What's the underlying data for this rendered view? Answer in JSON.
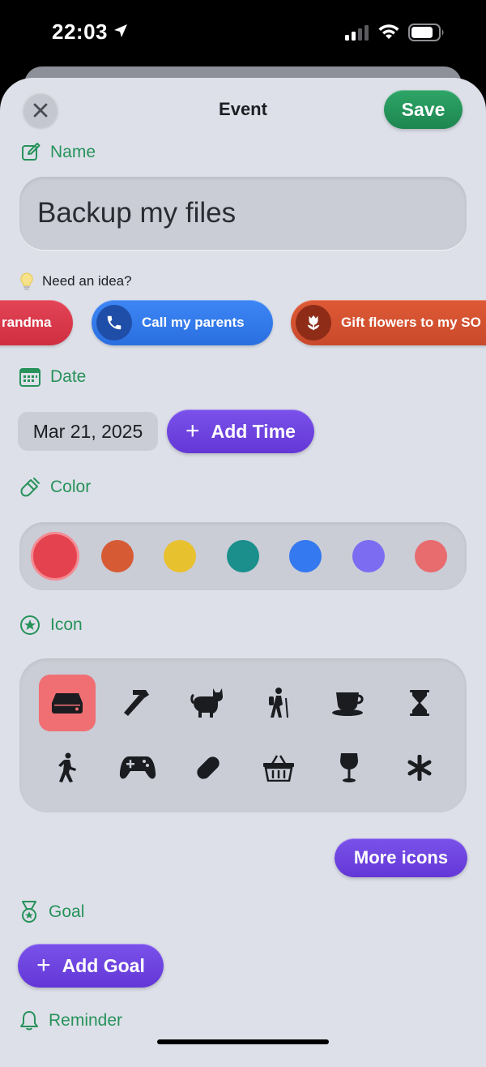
{
  "status": {
    "time": "22:03"
  },
  "header": {
    "title": "Event",
    "save_label": "Save"
  },
  "name_section": {
    "label": "Name",
    "value": "Backup my files"
  },
  "ideas": {
    "label": "Need an idea?",
    "suggestions": [
      {
        "label": "randma",
        "color": "#d9384a"
      },
      {
        "label": "Call my parents",
        "icon": "phone-icon",
        "color": "#3478f6"
      },
      {
        "label": "Gift flowers to my SO",
        "icon": "tulip-icon",
        "color": "#d4502f"
      }
    ]
  },
  "date_section": {
    "label": "Date",
    "value": "Mar 21, 2025",
    "add_time_label": "Add Time"
  },
  "color_section": {
    "label": "Color",
    "swatches": [
      "#e5424f",
      "#d65b34",
      "#e8c12f",
      "#1a8f8c",
      "#3479ef",
      "#7b6cf2",
      "#e86b6e"
    ],
    "selected_index": 0
  },
  "icon_section": {
    "label": "Icon",
    "icons": [
      "drive-icon",
      "hammer-icon",
      "cat-icon",
      "hiker-icon",
      "cup-icon",
      "hourglass-icon",
      "walking-icon",
      "gamepad-icon",
      "bandage-icon",
      "basket-icon",
      "wine-glass-icon",
      "asterisk-icon"
    ],
    "selected_index": 0,
    "more_label": "More icons"
  },
  "goal_section": {
    "label": "Goal",
    "add_goal_label": "Add Goal"
  },
  "reminder_section": {
    "label": "Reminder"
  },
  "colors": {
    "accent_green": "#27925a",
    "save_green": "#26985b",
    "purple": "#6b3fdc",
    "selected_icon_bg": "#ef6f73"
  }
}
